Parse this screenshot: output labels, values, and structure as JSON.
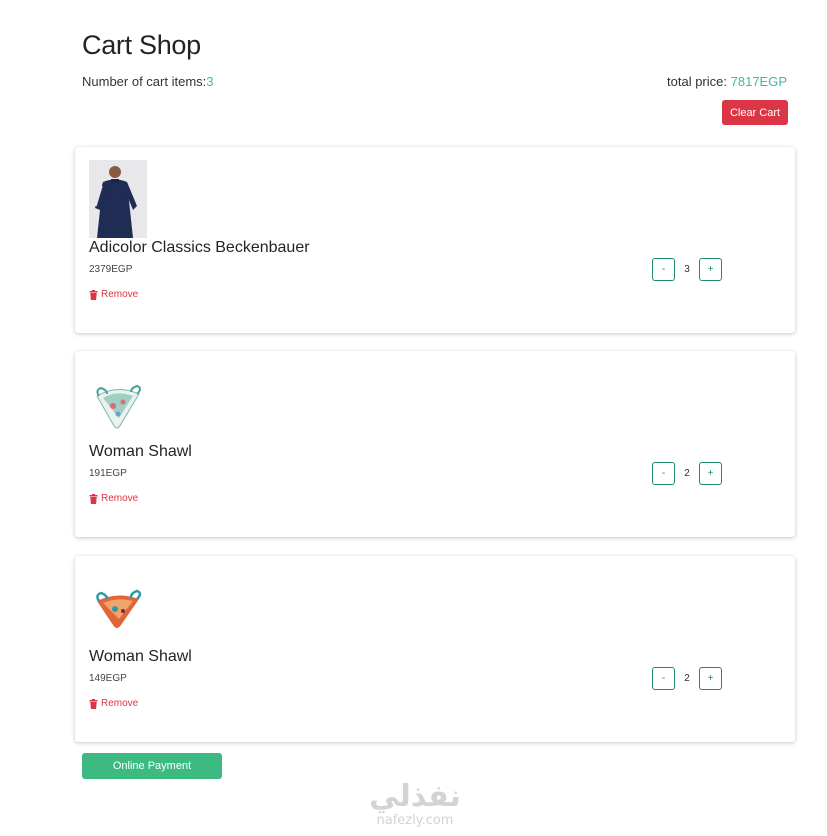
{
  "header": {
    "title": "Cart Shop",
    "count_label": "Number of cart items:",
    "count_value": "3",
    "total_label": "total price:",
    "total_value": "7817EGP",
    "clear_label": "Clear Cart"
  },
  "items": [
    {
      "name": "Adicolor Classics Beckenbauer",
      "price": "2379EGP",
      "remove": "Remove",
      "qty": "3",
      "minus": "-",
      "plus": "+"
    },
    {
      "name": "Woman Shawl",
      "price": "191EGP",
      "remove": "Remove",
      "qty": "2",
      "minus": "-",
      "plus": "+"
    },
    {
      "name": "Woman Shawl",
      "price": "149EGP",
      "remove": "Remove",
      "qty": "2",
      "minus": "-",
      "plus": "+"
    }
  ],
  "footer": {
    "pay_label": "Online Payment",
    "watermark_arabic": "نفذلي",
    "watermark_latin": "nafezly.com"
  },
  "colors": {
    "accent": "#3fb8a4",
    "danger": "#dc3545",
    "success": "#3dba82",
    "qty_border": "#1e8a6e"
  }
}
